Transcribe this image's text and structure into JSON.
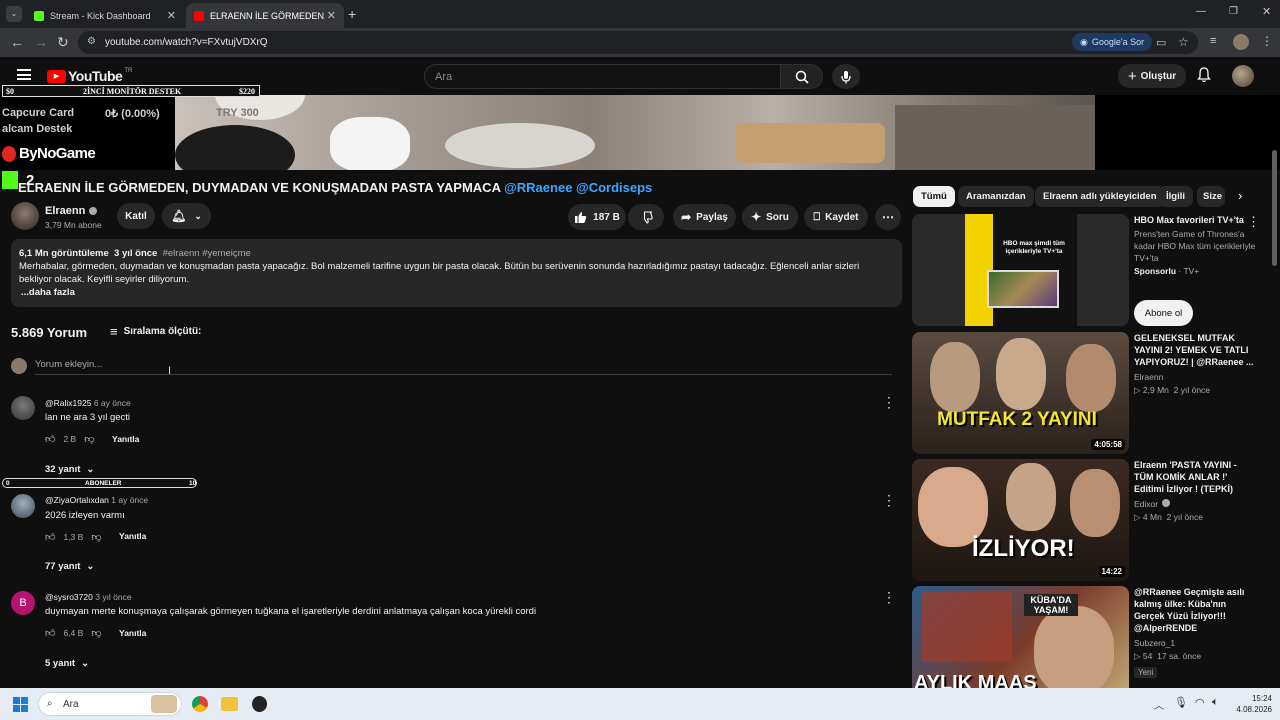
{
  "browser": {
    "tabs": [
      {
        "title": "Stream - Kick Dashboard",
        "favicon_color": "#53fc18"
      },
      {
        "title": "ELRAENN İLE GÖRMEDEN, DUY",
        "favicon_color": "#ff0000"
      }
    ],
    "url": "youtube.com/watch?v=FXvtujVDXrQ",
    "google_ask": "Google'a Sor"
  },
  "youtube": {
    "logo": "YouTube",
    "region": "TR",
    "search_placeholder": "Ara",
    "create_label": "Oluştur"
  },
  "overlay": {
    "bar_left": "$0",
    "bar_title": "2İNCİ MONİTÖR DESTEK",
    "bar_right": "$220",
    "line1_label": "Capcure Card",
    "line1_amount": "0₺ (0.00%)",
    "line1_target": "TRY 300",
    "line2_label": "alcam Destek",
    "sponsor": "ByNoGame",
    "kick_badge": "2"
  },
  "video": {
    "title_main": "ELRAENN İLE GÖRMEDEN, DUYMADAN VE KONUŞMADAN PASTA YAPMACA",
    "title_tags": "@RRaenee @Cordiseps",
    "channel": "Elraenn",
    "subscribers": "3,79 Mn abone",
    "join_label": "Katıl",
    "likes": "187 B",
    "share_label": "Paylaş",
    "ask_label": "Soru",
    "save_label": "Kaydet",
    "views": "6,1 Mn görüntüleme",
    "age": "3 yıl önce",
    "hashtags": "#elraenn #yemeiçme",
    "description": "Merhabalar, görmeden, duymadan ve konuşmadan pasta yapacağız. Bol malzemeli tarifine uygun bir pasta olacak. Bütün bu serüvenin sonunda hazırladığımız pastayı tadacağız. Eğlenceli anlar sizleri bekliyor olacak. Keyifli seyirler diliyorum.",
    "more_label": "...daha fazla"
  },
  "comments_section": {
    "count": "5.869 Yorum",
    "sort_label": "Sıralama ölçütü:",
    "add_placeholder": "Yorum ekleyin...",
    "subs_bar": {
      "left": "0",
      "label": "ABONELER",
      "right": "10"
    },
    "comments": [
      {
        "author": "@Ralix1925",
        "time": "6 ay önce",
        "text": "lan ne ara 3 yıl gecti",
        "likes": "2 B",
        "reply_label": "Yanıtla",
        "replies": "32 yanıt",
        "avatar_color": "#5a5a5a"
      },
      {
        "author": "@ZiyaOrtalıxdan",
        "time": "1 ay önce",
        "text": "2026 izleyen varmı",
        "likes": "1,3 B",
        "reply_label": "Yanıtla",
        "replies": "77 yanıt",
        "avatar_color": "#6d7a86"
      },
      {
        "author": "@sysro3720",
        "time": "3 yıl önce",
        "text": "duymayan merte konuşmaya çalışarak görmeyen tuğkana el işaretleriyle derdini anlatmaya çalışan koca yürekli cordi",
        "likes": "6,4 B",
        "reply_label": "Yanıtla",
        "replies": "5 yanıt",
        "avatar_color": "#b5136f",
        "avatar_letter": "B"
      }
    ]
  },
  "sidebar": {
    "chips": [
      "Tümü",
      "Aramanızdan",
      "Elraenn adlı yükleyiciden",
      "İlgili",
      "Size"
    ],
    "ad": {
      "title": "HBO Max favorileri TV+'ta",
      "desc": "Prens'ten Game of Thrones'a kadar HBO Max tüm içerikleriyle TV+'ta",
      "sponsor_label": "Sponsorlu",
      "advertiser": "TV+",
      "cta": "Abone ol",
      "thumb_text": "HBO max şimdi tüm içerikleriyle TV+'ta"
    },
    "videos": [
      {
        "title": "GELENEKSEL MUTFAK YAYINI 2! YEMEK VE TATLI YAPIYORUZ! | @RRaenee ...",
        "channel": "Elraenn",
        "views": "2,9 Mn",
        "age": "2 yıl önce",
        "duration": "4:05:58",
        "thumb_text": "MUTFAK 2 YAYINI"
      },
      {
        "title": "Elraenn 'PASTA YAYINI - TÜM KOMİK ANLAR !' Editimi İzliyor ! (TEPKİ)",
        "channel": "Edixor",
        "views": "4 Mn",
        "age": "2 yıl önce",
        "duration": "14:22",
        "thumb_text": "İZLİYOR!"
      },
      {
        "title": "@RRaenee  Geçmişte asılı kalmış ülke: Küba'nın Gerçek Yüzü İzliyor!!! @AlperRENDE",
        "channel": "Subzero_1",
        "views": "54",
        "age": "17 sa. önce",
        "badge": "Yeni",
        "thumb_text": "AYLIK MAAŞ",
        "thumb_text2": "KÜBA'DA YAŞAM!"
      }
    ]
  },
  "taskbar": {
    "search_placeholder": "Ara",
    "time": "15:24",
    "date": "4.08.2026"
  }
}
